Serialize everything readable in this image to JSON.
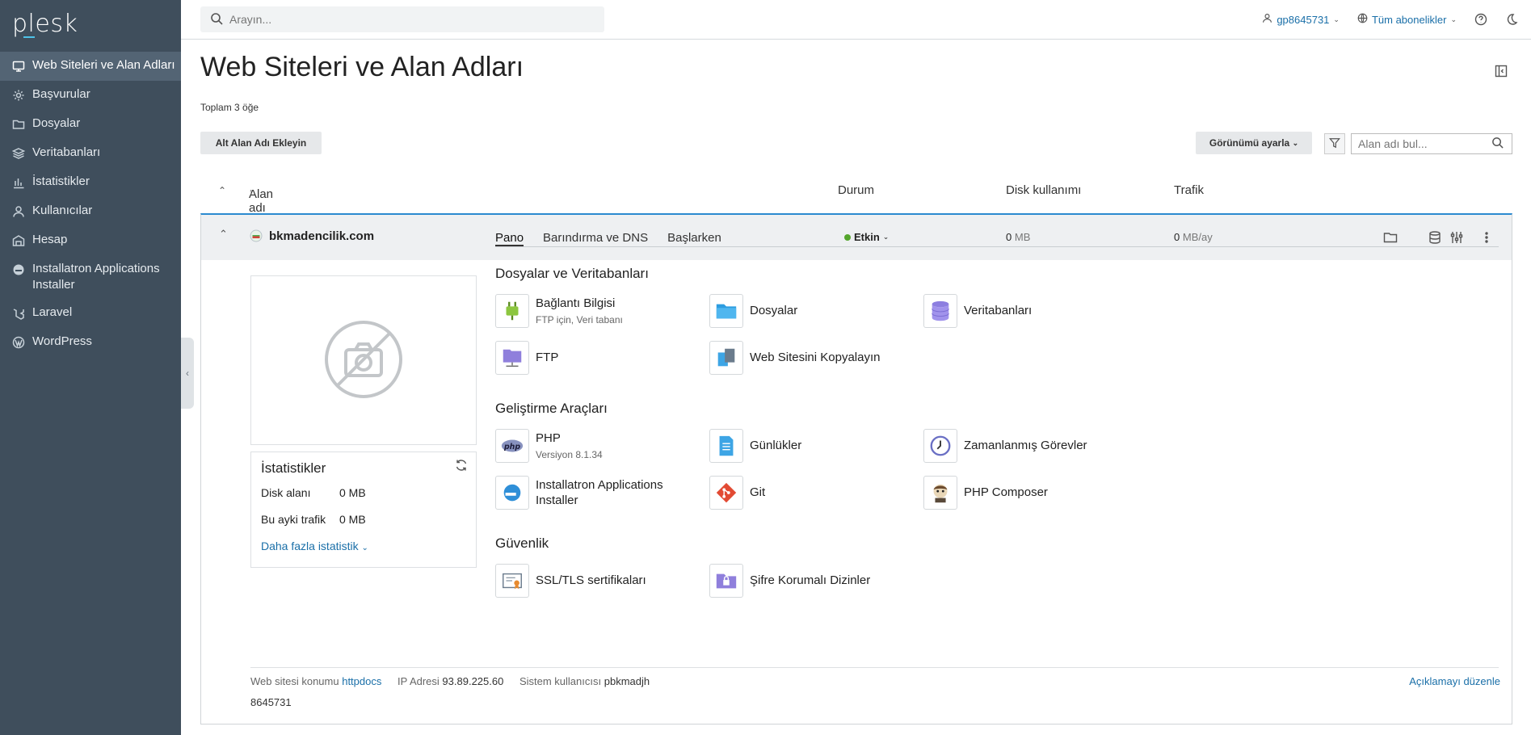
{
  "sidebar": {
    "logo": "plesk",
    "items": [
      {
        "label": "Web Siteleri ve Alan Adları",
        "icon": "monitor-icon"
      },
      {
        "label": "Başvurular",
        "icon": "gear-icon"
      },
      {
        "label": "Dosyalar",
        "icon": "folder-icon"
      },
      {
        "label": "Veritabanları",
        "icon": "layers-icon"
      },
      {
        "label": "İstatistikler",
        "icon": "bar-chart-icon"
      },
      {
        "label": "Kullanıcılar",
        "icon": "user-icon"
      },
      {
        "label": "Hesap",
        "icon": "briefcase-icon"
      },
      {
        "label": "Installatron Applications Installer",
        "icon": "installatron-icon"
      },
      {
        "label": "Laravel",
        "icon": "laravel-icon"
      },
      {
        "label": "WordPress",
        "icon": "wordpress-icon"
      }
    ]
  },
  "topbar": {
    "search_placeholder": "Arayın...",
    "user": "gp8645731",
    "subscriptions": "Tüm abonelikler"
  },
  "main": {
    "title": "Web Siteleri ve Alan Adları",
    "total": "Toplam 3 öğe",
    "add_subdomain_button": "Alt Alan Adı Ekleyin",
    "view_button": "Görünümü ayarla",
    "domain_search_placeholder": "Alan adı bul...",
    "columns": {
      "name": "Alan adı",
      "sort_arrow": "↑",
      "status": "Durum",
      "disk": "Disk kullanımı",
      "traffic": "Trafik"
    }
  },
  "domain": {
    "name": "bkmadencilik.com",
    "status": "Etkin",
    "disk_value": "0",
    "disk_unit": "MB",
    "traffic_value": "0",
    "traffic_unit": "MB/ay",
    "stats": {
      "title": "İstatistikler",
      "disk_label": "Disk alanı",
      "disk_value": "0 MB",
      "traffic_label": "Bu ayki trafik",
      "traffic_value": "0 MB",
      "more": "Daha fazla istatistik"
    },
    "tabs": [
      "Pano",
      "Barındırma ve DNS",
      "Başlarken"
    ],
    "sections": {
      "files": "Dosyalar ve Veritabanları",
      "dev": "Geliştirme Araçları",
      "security": "Güvenlik"
    },
    "tools": {
      "connection": {
        "label": "Bağlantı Bilgisi",
        "sub": "FTP için, Veri tabanı"
      },
      "files": {
        "label": "Dosyalar"
      },
      "databases": {
        "label": "Veritabanları"
      },
      "ftp": {
        "label": "FTP"
      },
      "copy": {
        "label": "Web Sitesini Kopyalayın"
      },
      "php": {
        "label": "PHP",
        "sub": "Versiyon 8.1.34"
      },
      "logs": {
        "label": "Günlükler"
      },
      "cron": {
        "label": "Zamanlanmış Görevler"
      },
      "installatron": {
        "label": "Installatron Applications Installer"
      },
      "git": {
        "label": "Git"
      },
      "composer": {
        "label": "PHP Composer"
      },
      "ssl": {
        "label": "SSL/TLS sertifikaları"
      },
      "protected": {
        "label": "Şifre Korumalı Dizinler"
      }
    },
    "footer": {
      "location_label": "Web sitesi konumu",
      "location_value": "httpdocs",
      "ip_label": "IP Adresi",
      "ip_value": "93.89.225.60",
      "sysuser_label": "Sistem kullanıcısı",
      "sysuser_value": "pbkmadjh",
      "edit_description": "Açıklamayı düzenle",
      "id": "8645731"
    }
  },
  "colors": {
    "sidebar": "#3f4e5c",
    "active_nav": "#536474",
    "link": "#1a6fa8",
    "status_ok": "#54a52d",
    "accent_border": "#2b8ad0"
  }
}
